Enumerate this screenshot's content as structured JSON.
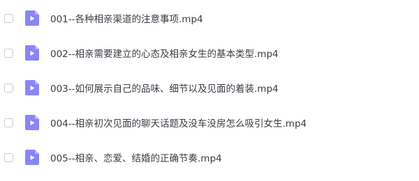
{
  "colors": {
    "icon_fill": "#8b86f5",
    "icon_fold": "#b9b5fa",
    "text": "#3b3d45",
    "checkbox_border": "#c9ccd3"
  },
  "files": [
    {
      "name": "001--各种相亲渠道的注意事项.mp4",
      "icon": "video-file-icon",
      "checked": false
    },
    {
      "name": "002--相亲需要建立的心态及相亲女生的基本类型.mp4",
      "icon": "video-file-icon",
      "checked": false
    },
    {
      "name": "003--如何展示自己的品味、细节以及见面的着装.mp4",
      "icon": "video-file-icon",
      "checked": false
    },
    {
      "name": "004--相亲初次见面的聊天话题及没车没房怎么吸引女生.mp4",
      "icon": "video-file-icon",
      "checked": false
    },
    {
      "name": "005--相亲、恋爱、结婚的正确节奏.mp4",
      "icon": "video-file-icon",
      "checked": false
    }
  ]
}
